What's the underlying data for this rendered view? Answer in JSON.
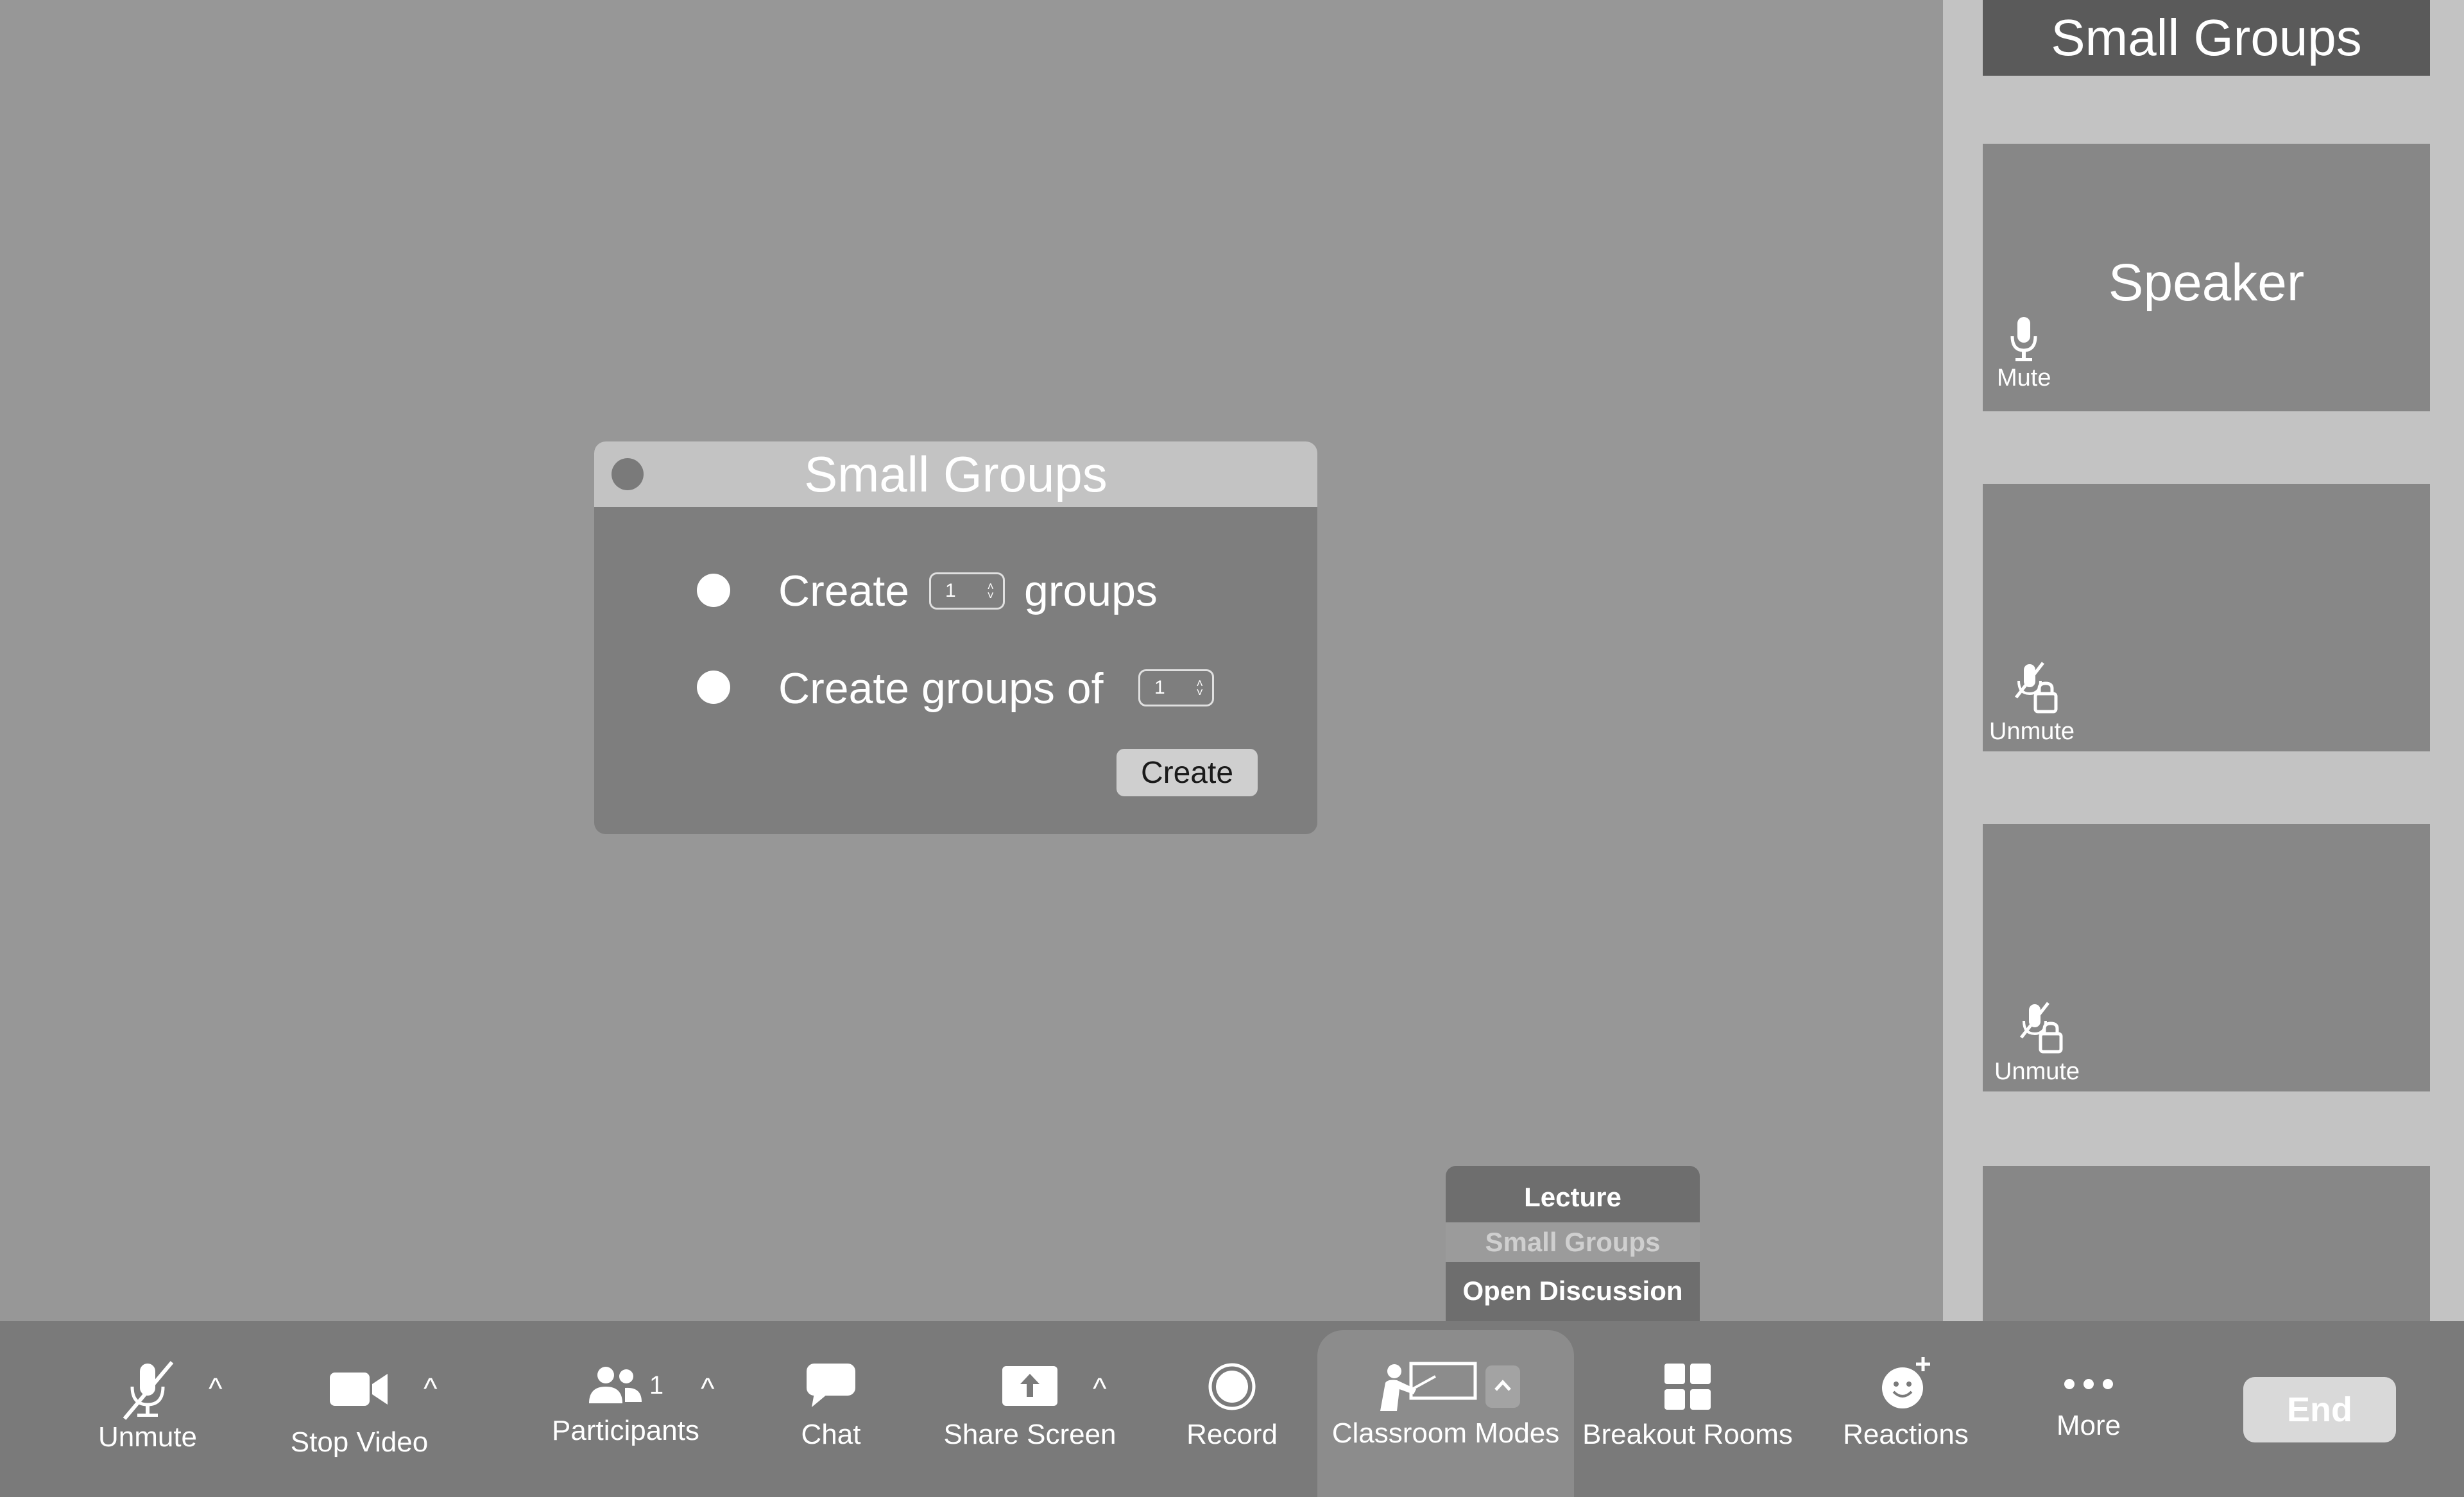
{
  "sidebar": {
    "title": "Small Groups",
    "tiles": [
      {
        "label": "Speaker",
        "audio_label": "Mute"
      },
      {
        "label": "",
        "audio_label": "Unmute"
      },
      {
        "label": "",
        "audio_label": "Unmute"
      },
      {
        "label": "",
        "audio_label": ""
      }
    ]
  },
  "dialog": {
    "title": "Small Groups",
    "option1": {
      "prefix": "Create",
      "value": "1",
      "suffix": "groups"
    },
    "option2": {
      "prefix": "Create groups of",
      "value": "1"
    },
    "create_label": "Create"
  },
  "mode_menu": {
    "items": [
      "Lecture",
      "Small Groups",
      "Open Discussion"
    ],
    "selected": "Small Groups"
  },
  "toolbar": {
    "unmute": "Unmute",
    "stop_video": "Stop Video",
    "participants": "Participants",
    "participants_count": "1",
    "chat": "Chat",
    "share_screen": "Share Screen",
    "record": "Record",
    "classroom_modes": "Classroom Modes",
    "breakout_rooms": "Breakout Rooms",
    "reactions": "Reactions",
    "more": "More",
    "end": "End"
  }
}
